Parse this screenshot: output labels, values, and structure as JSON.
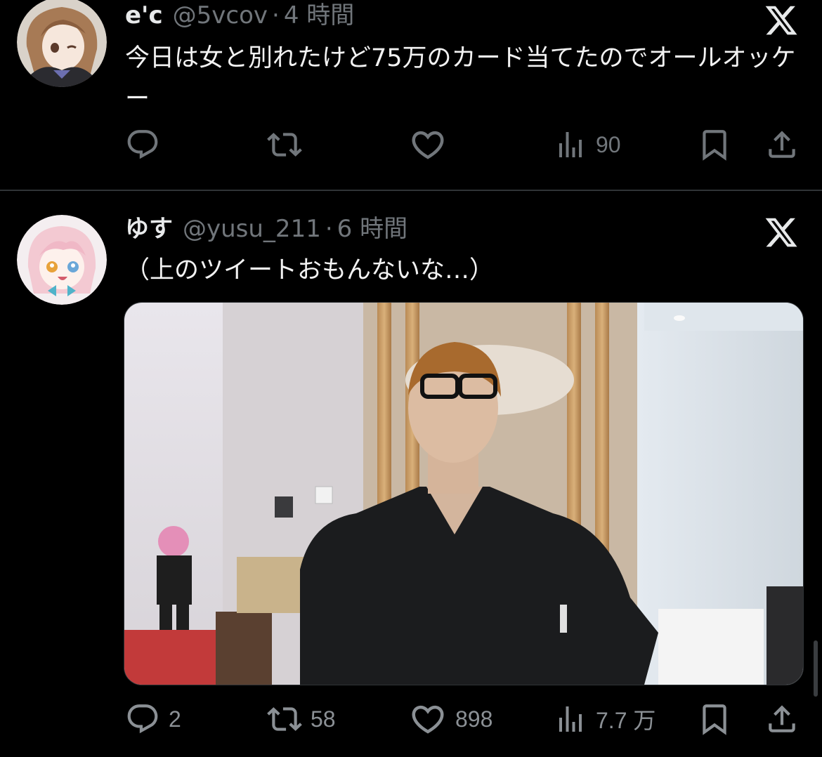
{
  "tweets": [
    {
      "display_name": "e'c",
      "handle": "@5vcov",
      "separator": "·",
      "time": "4 時間",
      "text": "今日は女と別れたけど75万のカード当てたのでオールオッケー",
      "avatar": "anime-girl-brown-hair-avatar",
      "stats": {
        "replies": "",
        "retweets": "",
        "likes": "",
        "views": "90"
      }
    },
    {
      "display_name": "ゆす",
      "handle": "@yusu_211",
      "separator": "·",
      "time": "6 時間",
      "text": "（上のツイートおもんないな…）",
      "avatar": "anime-girl-pink-hair-avatar",
      "media": "photo-man-with-glasses-looking-up",
      "stats": {
        "replies": "2",
        "retweets": "58",
        "likes": "898",
        "views": "7.7 万"
      }
    }
  ],
  "icons": {
    "reply": "reply-icon",
    "retweet": "retweet-icon",
    "like": "heart-icon",
    "views": "views-icon",
    "bookmark": "bookmark-icon",
    "share": "share-icon",
    "logo": "x-logo-icon"
  },
  "colors": {
    "background": "#000000",
    "text": "#e7e9ea",
    "secondary": "#71767b",
    "divider": "#2f3336"
  }
}
